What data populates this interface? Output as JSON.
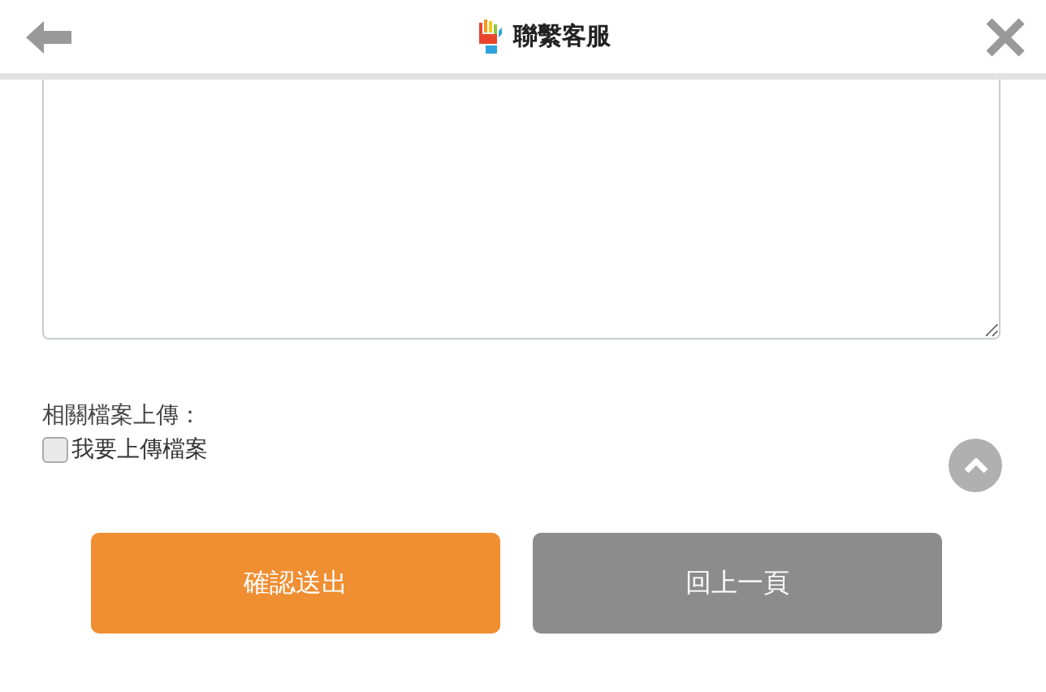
{
  "header": {
    "title": "聯繫客服"
  },
  "upload": {
    "label": "相關檔案上傳：",
    "checkbox": {
      "label": "我要上傳檔案",
      "checked": false
    }
  },
  "buttons": [
    {
      "label": "確認送出",
      "kind": "primary"
    },
    {
      "label": "回上一頁",
      "kind": "secondary"
    }
  ]
}
